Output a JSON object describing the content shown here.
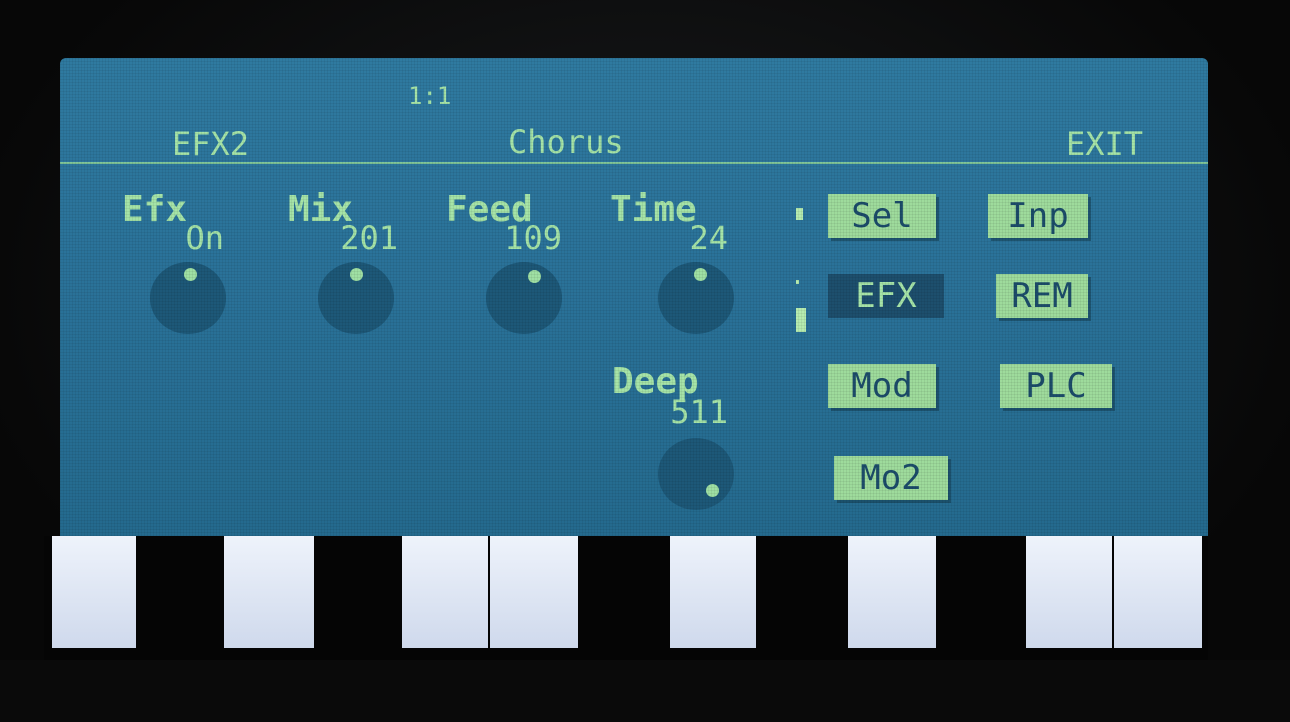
{
  "header": {
    "pattern_position": "1:1",
    "left_label": "EFX2",
    "title": "Chorus",
    "exit_label": "EXIT"
  },
  "params": [
    {
      "label": "Efx",
      "value": "On",
      "knob_fraction": 0.05
    },
    {
      "label": "Mix",
      "value": "201",
      "knob_fraction": 0.0
    },
    {
      "label": "Feed",
      "value": "109",
      "knob_fraction": 0.2
    },
    {
      "label": "Time",
      "value": "24",
      "knob_fraction": 0.08
    },
    {
      "label": "Deep",
      "value": "511",
      "knob_fraction": 1.0
    }
  ],
  "menu_buttons": [
    {
      "label": "Sel",
      "active": false
    },
    {
      "label": "Inp",
      "active": false
    },
    {
      "label": "EFX",
      "active": true
    },
    {
      "label": "REM",
      "active": false
    },
    {
      "label": "Mod",
      "active": false
    },
    {
      "label": "PLC",
      "active": false
    },
    {
      "label": "Mo2",
      "active": false
    }
  ],
  "colors": {
    "screen_bg": "#2a7299",
    "text": "#a6e4a8",
    "button_bg": "#9edb9c",
    "button_text": "#1c4c6a",
    "knob": "#1d5878"
  }
}
